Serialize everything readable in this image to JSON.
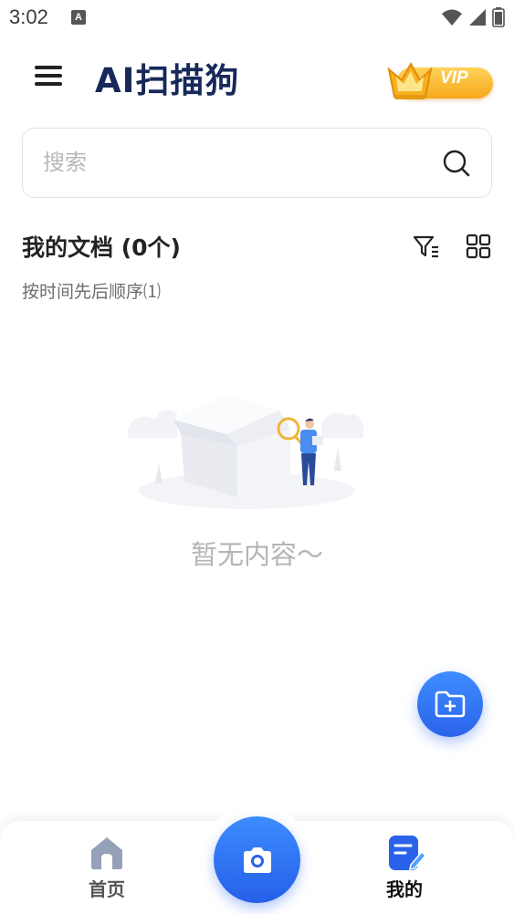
{
  "status_bar": {
    "time": "3:02",
    "notification_glyph": "A"
  },
  "header": {
    "menu_icon": "hamburger-icon",
    "title": "AI扫描狗",
    "vip_label": "VIP"
  },
  "search": {
    "placeholder": "搜索",
    "value": ""
  },
  "documents": {
    "title": "我的文档 (0个)",
    "sort_label": "按时间先后顺序⑴",
    "filter_icon": "filter-icon",
    "view_icon": "grid-view-icon",
    "empty_text": "暂无内容～"
  },
  "fab": {
    "icon": "new-folder-icon"
  },
  "bottom_nav": {
    "items": [
      {
        "label": "首页",
        "icon": "home-icon"
      },
      {
        "label": "我的",
        "icon": "document-icon"
      }
    ],
    "camera_icon": "camera-icon"
  },
  "colors": {
    "brand": "#2a63ea",
    "title": "#17295a",
    "vip": "#f7a81c"
  }
}
